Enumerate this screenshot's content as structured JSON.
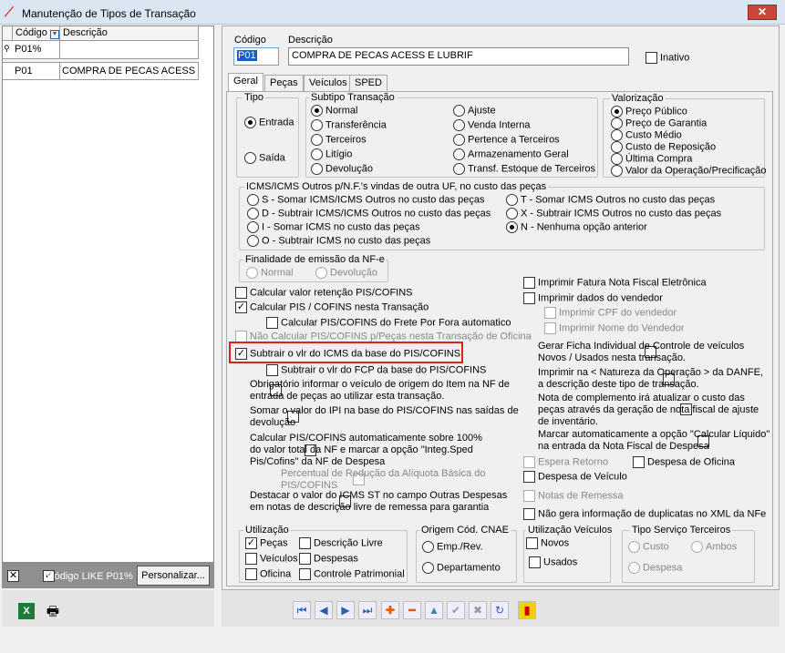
{
  "window": {
    "title": "Manutenção de Tipos de Transação",
    "close": "✕"
  },
  "grid": {
    "col_code": "Código",
    "col_desc": "Descrição",
    "filter_value": "P01%",
    "rows": [
      {
        "code": "P01",
        "desc": "COMPRA DE PECAS ACESS E LU"
      }
    ]
  },
  "left_footer": {
    "filter_text": "(Código LIKE P01%",
    "customize_label": "Personalizar..."
  },
  "form": {
    "code_label": "Código",
    "code_value": "P01",
    "desc_label": "Descrição",
    "desc_value": "COMPRA DE PECAS ACESS E LUBRIF",
    "inactive_label": "Inativo"
  },
  "tabs": [
    "Geral",
    "Peças",
    "Veículos",
    "SPED"
  ],
  "tipo": {
    "title": "Tipo",
    "entrada": "Entrada",
    "saida": "Saída"
  },
  "subtipo": {
    "title": "Subtipo Transação",
    "options": [
      "Normal",
      "Transferência",
      "Terceiros",
      "Litígio",
      "Devolução",
      "Ajuste",
      "Venda Interna",
      "Pertence a Terceiros",
      "Armazenamento Geral",
      "Transf. Estoque de Terceiros"
    ]
  },
  "valorizacao": {
    "title": "Valorização",
    "options": [
      "Preço Público",
      "Preço de Garantia",
      "Custo Médio",
      "Custo de Reposição",
      "Última Compra",
      "Valor da Operação/Precificação"
    ]
  },
  "icms": {
    "title": "ICMS/ICMS Outros p/N.F.'s vindas de outra UF, no custo das peças",
    "options": [
      "S - Somar ICMS/ICMS Outros no custo das peças",
      "D - Subtrair ICMS/ICMS Outros no custo das peças",
      "I - Somar ICMS no custo das peças",
      "O - Subtrair ICMS no custo das peças",
      "T - Somar ICMS Outros no custo das peças",
      "X - Subtrair ICMS Outros no custo das peças",
      "N - Nenhuma opção anterior"
    ]
  },
  "finalidade": {
    "title": "Finalidade de emissão da NF-e",
    "normal": "Normal",
    "devolucao": "Devolução"
  },
  "left_checks": {
    "c1": "Calcular valor retenção PIS/COFINS",
    "c2": "Calcular PIS / COFINS nesta Transação",
    "c3": "Calcular PIS/COFINS do Frete Por Fora automatico",
    "c4": "Não Calcular PIS/COFINS p/Peças nesta Transação de Oficina",
    "c5": "Subtrair o vlr do ICMS da base do PIS/COFINS",
    "c6": "Subtrair o vlr do FCP da base do PIS/COFINS",
    "c7a": "Obrigatório informar o veículo de origem do Item na NF de",
    "c7b": "entrada de peças ao utilizar esta transação.",
    "c8a": "Somar o valor do IPI na base do PIS/COFINS nas saídas de",
    "c8b": "devolução",
    "c9a": "Calcular PIS/COFINS automaticamente sobre 100%",
    "c9b": "do valor total da NF e marcar a opção \"Integ.Sped",
    "c9c": "Pis/Cofins\" da NF de Despesa",
    "c10a": "Percentual de Redução da Alíquota Básica do",
    "c10b": "PIS/COFINS",
    "c11a": "Destacar o valor do ICMS ST no campo Outras Despesas",
    "c11b": "em notas de descrição livre de remessa para garantia"
  },
  "right_checks": {
    "r1": "Imprimir Fatura Nota Fiscal Eletrônica",
    "r2": "Imprimir dados do vendedor",
    "r3": "Imprimir CPF do vendedor",
    "r4": "Imprimir Nome do Vendedor",
    "r5a": "Gerar Ficha Individual de Controle de veículos",
    "r5b": "Novos / Usados  nesta transação.",
    "r6a": "Imprimir na < Natureza da Operação > da DANFE,",
    "r6b": "a descrição deste tipo de transação.",
    "r7a": "Nota de complemento irá atualizar o custo das",
    "r7b": "peças através da geração de nota fiscal de ajuste",
    "r7c": "de inventário.",
    "r8a": "Marcar automaticamente a opção \"Calcular Líquido\"",
    "r8b": "na entrada da Nota Fiscal de Despesa",
    "r9": "Espera Retorno",
    "r10": "Despesa de Oficina",
    "r11": "Despesa de Veículo",
    "r12": "Notas de Remessa",
    "r13": "Não gera informação de duplicatas no XML da NFe"
  },
  "utilizacao": {
    "title": "Utilização",
    "pecas": "Peças",
    "veiculos": "Veículos",
    "oficina": "Oficina",
    "descricao_livre": "Descrição Livre",
    "despesas": "Despesas",
    "controle": "Controle Patrimonial"
  },
  "origem": {
    "title": "Origem Cód. CNAE",
    "emp": "Emp./Rev.",
    "dep": "Departamento"
  },
  "util_veic": {
    "title": "Utilização Veículos",
    "novos": "Novos",
    "usados": "Usados"
  },
  "servico": {
    "title": "Tipo Serviço Terceiros",
    "custo": "Custo",
    "ambos": "Ambos",
    "despesa": "Despesa"
  },
  "nav_icons": [
    "first-icon",
    "prev-icon",
    "next-icon",
    "last-icon",
    "add-icon",
    "delete-icon",
    "up-icon",
    "confirm-icon",
    "cancel-icon",
    "refresh-icon",
    "exit-icon"
  ],
  "colors": {
    "highlight": "#e02020",
    "accent": "#1a4fa0"
  }
}
